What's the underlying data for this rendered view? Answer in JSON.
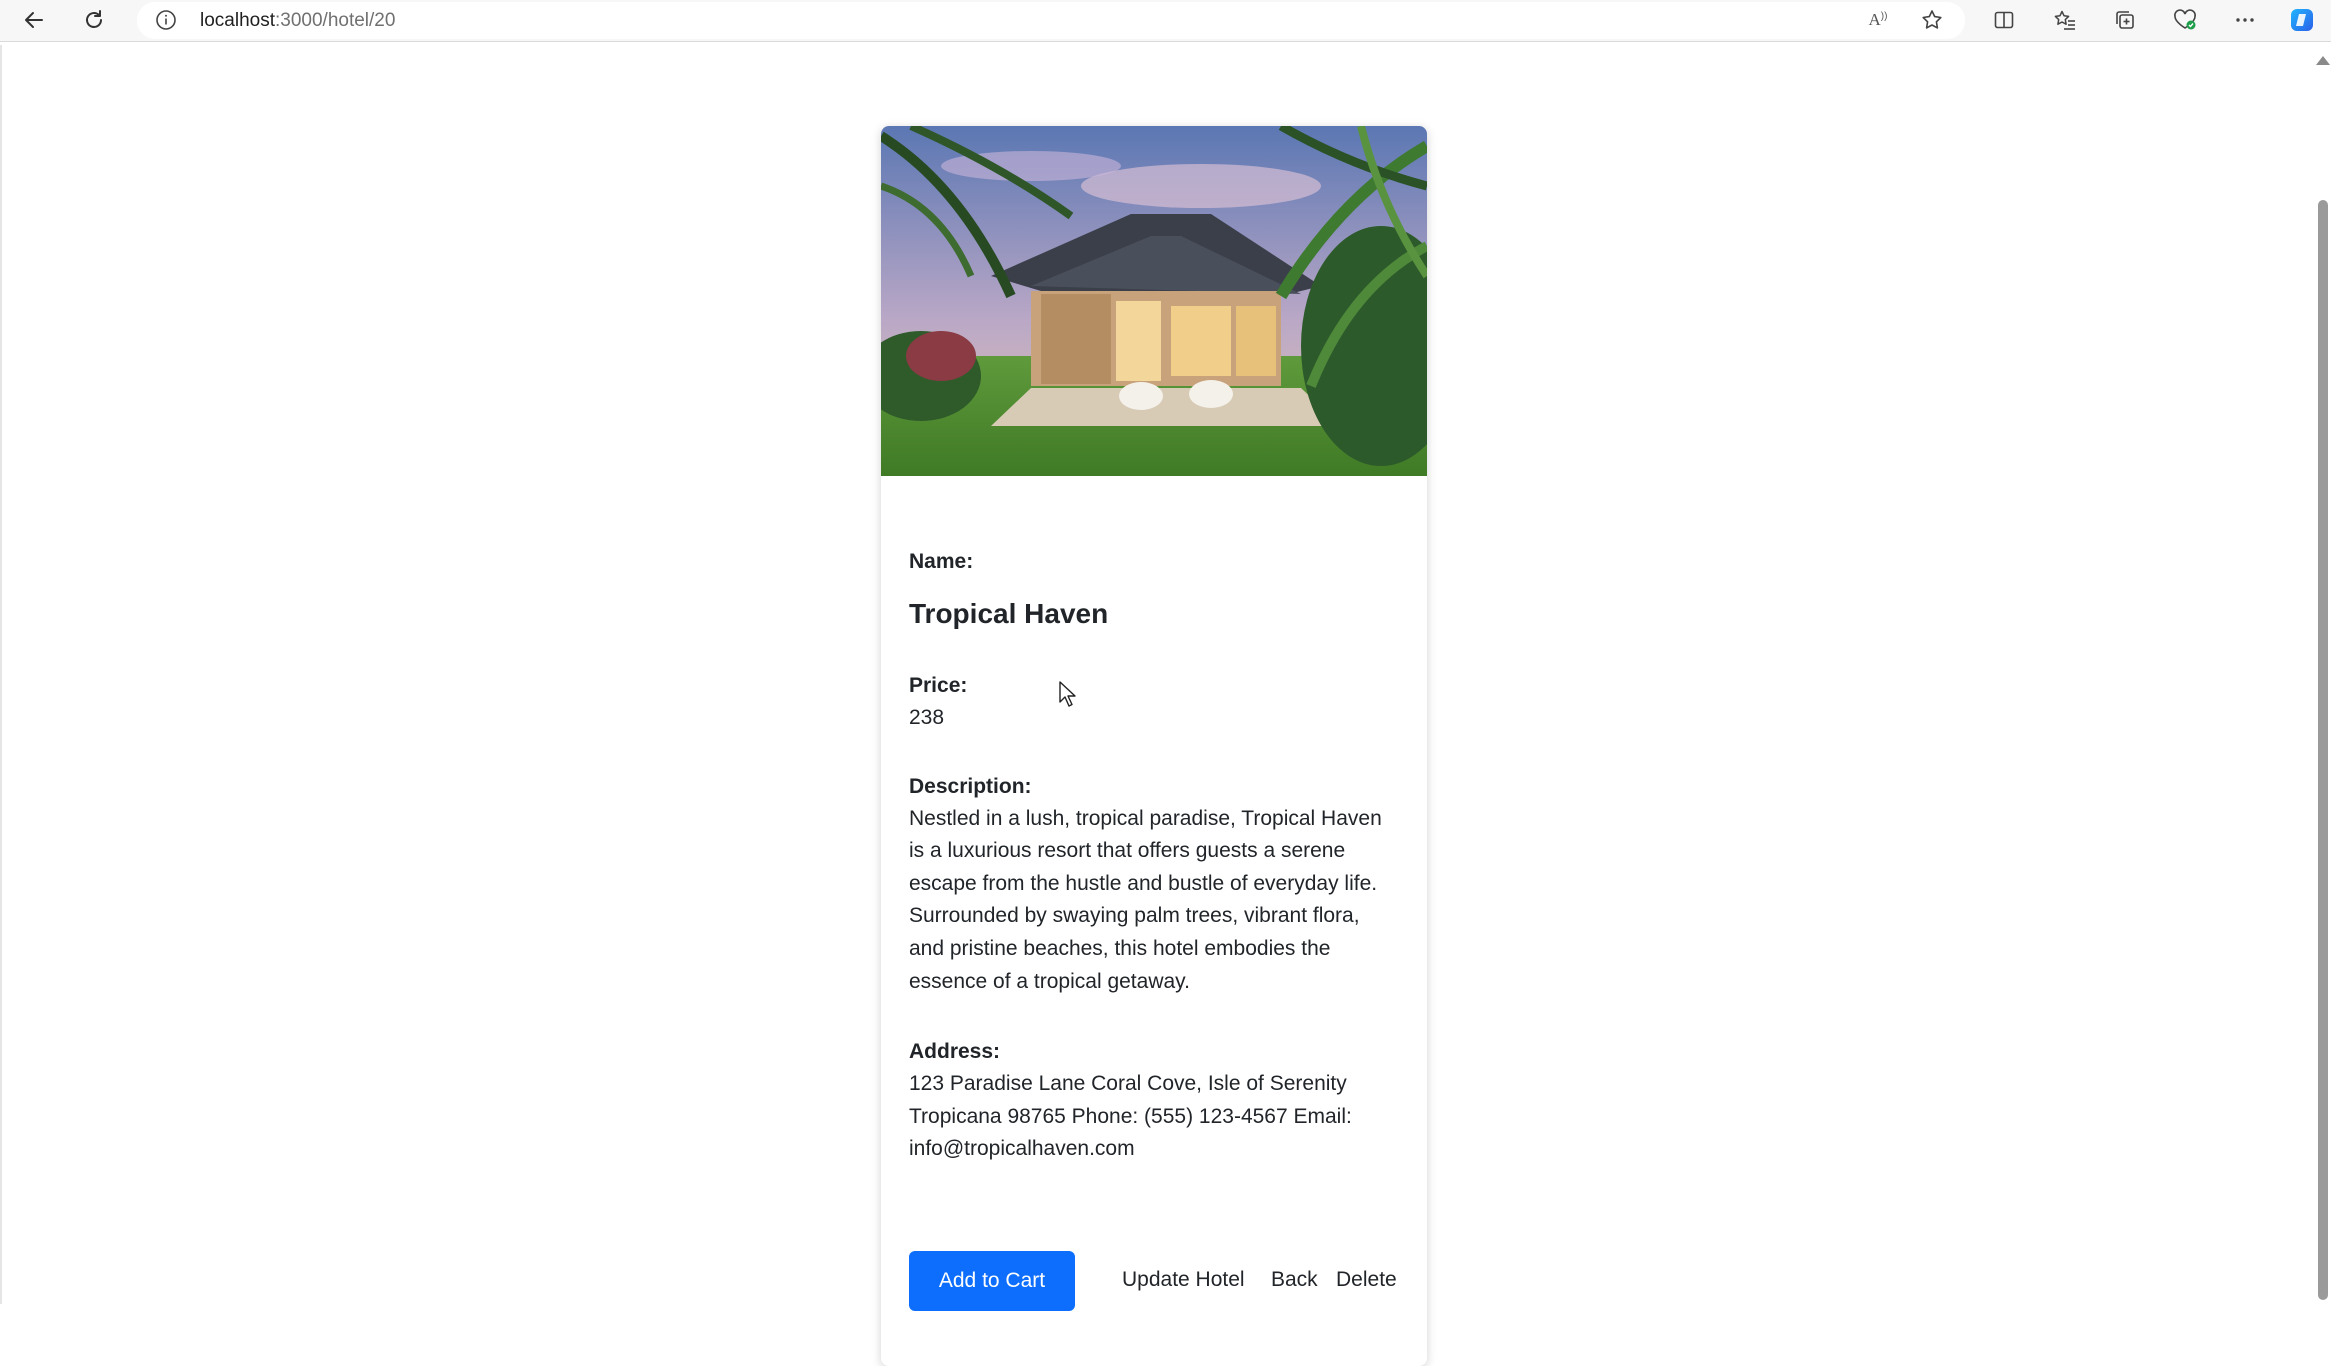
{
  "browser": {
    "url_host": "localhost",
    "url_path": ":3000/hotel/20",
    "read_aloud_label": "A"
  },
  "hotel": {
    "name_label": "Name:",
    "name": "Tropical Haven",
    "price_label": "Price:",
    "price": "238",
    "description_label": "Description:",
    "description_lines": [
      "Nestled in a lush, tropical paradise, Tropical Haven",
      "is a luxurious resort that offers guests a serene",
      "escape from the hustle and bustle of everyday life.",
      "Surrounded by swaying palm trees, vibrant flora,",
      "and pristine beaches, this hotel embodies the",
      "essence of a tropical getaway."
    ],
    "address_label": "Address:",
    "address_lines": [
      "123 Paradise Lane Coral Cove, Isle of Serenity",
      "Tropicana 98765 Phone: (555) 123-4567 Email:",
      "info@tropicalhaven.com"
    ]
  },
  "actions": {
    "add_to_cart": "Add to Cart",
    "update_hotel": "Update Hotel",
    "back": "Back",
    "delete": "Delete"
  },
  "colors": {
    "primary": "#0d6efd",
    "text": "#212529"
  }
}
